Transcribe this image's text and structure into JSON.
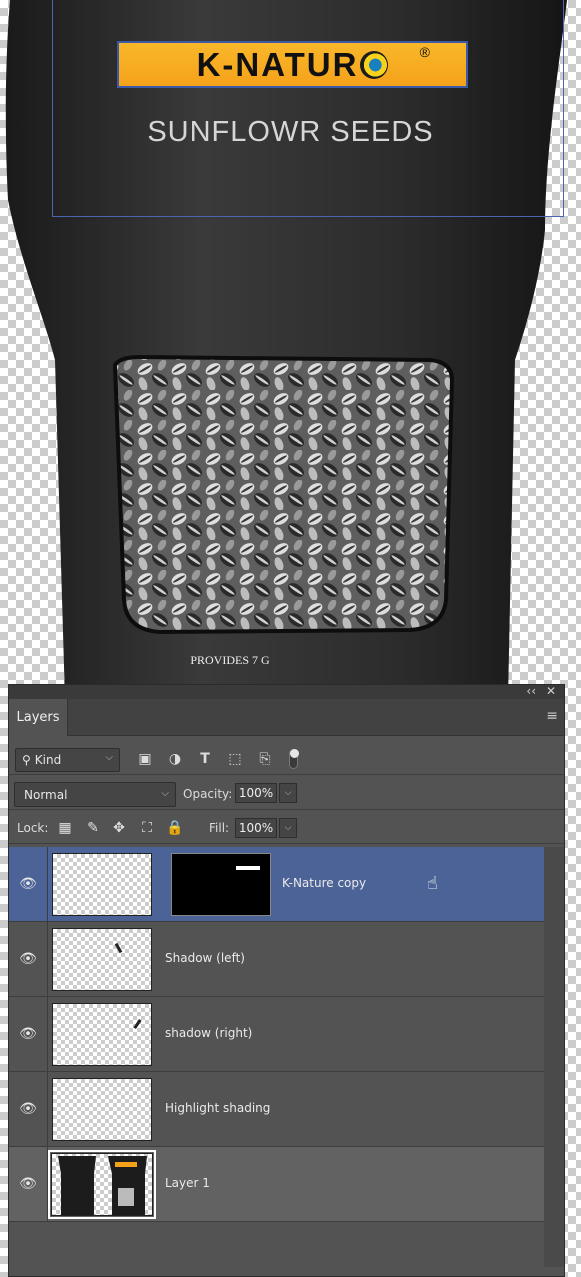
{
  "canvas": {
    "logo_text": "K-NATUR",
    "logo_mark": "®",
    "product_name": "SUNFLOWR SEEDS",
    "bottom_text": "PROVIDES 7 G"
  },
  "panel": {
    "title": "Layers",
    "collapse_label": "‹‹",
    "close_label": "✕",
    "menu_icon": "hamburger-icon",
    "filter": {
      "kind_label": "Kind",
      "icons": [
        "image-filter-icon",
        "adjustment-filter-icon",
        "type-filter-icon",
        "shape-filter-icon",
        "smart-object-filter-icon"
      ]
    },
    "blend_mode": "Normal",
    "opacity_label": "Opacity:",
    "opacity_value": "100%",
    "lock_label": "Lock:",
    "fill_label": "Fill:",
    "fill_value": "100%",
    "layers": [
      {
        "name": "K-Nature copy",
        "selected": true
      },
      {
        "name": "Shadow (left)",
        "selected": false
      },
      {
        "name": "shadow (right)",
        "selected": false
      },
      {
        "name": "Highlight shading",
        "selected": false
      },
      {
        "name": "Layer 1",
        "selected": false
      }
    ]
  },
  "colors": {
    "panel_bg": "#535353",
    "selected_row": "#4b6397",
    "logo_bg": "#f5a21a"
  }
}
